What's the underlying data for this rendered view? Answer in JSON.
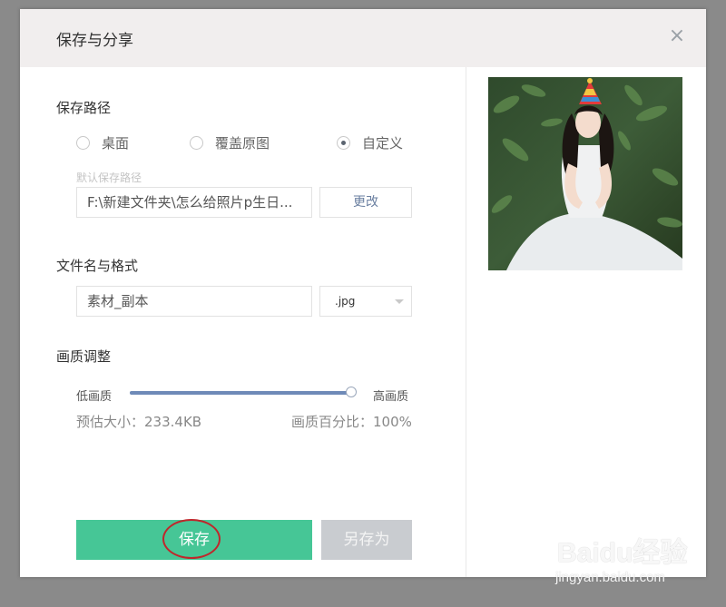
{
  "dialog": {
    "title": "保存与分享",
    "close_icon": "close-icon"
  },
  "save_path": {
    "heading": "保存路径",
    "options": [
      {
        "label": "桌面",
        "checked": false
      },
      {
        "label": "覆盖原图",
        "checked": false
      },
      {
        "label": "自定义",
        "checked": true
      }
    ],
    "hint": "默认保存路径",
    "path_value": "F:\\新建文件夹\\怎么给照片p生日...",
    "change_label": "更改"
  },
  "file": {
    "heading": "文件名与格式",
    "name_value": "素材_副本",
    "format_value": ".jpg"
  },
  "quality": {
    "heading": "画质调整",
    "low_label": "低画质",
    "high_label": "高画质",
    "level": 1.0,
    "estimate": "预估大小：233.4KB",
    "percent": "画质百分比：100%"
  },
  "actions": {
    "save_label": "保存",
    "save_as_label": "另存为"
  },
  "colors": {
    "primary": "#46c696",
    "disabled": "#c9ccd0",
    "annotation": "#c0262b",
    "slider": "#6e8ab8"
  },
  "watermark": {
    "logo": "Baidu经验",
    "url": "jingyan.baidu.com"
  }
}
